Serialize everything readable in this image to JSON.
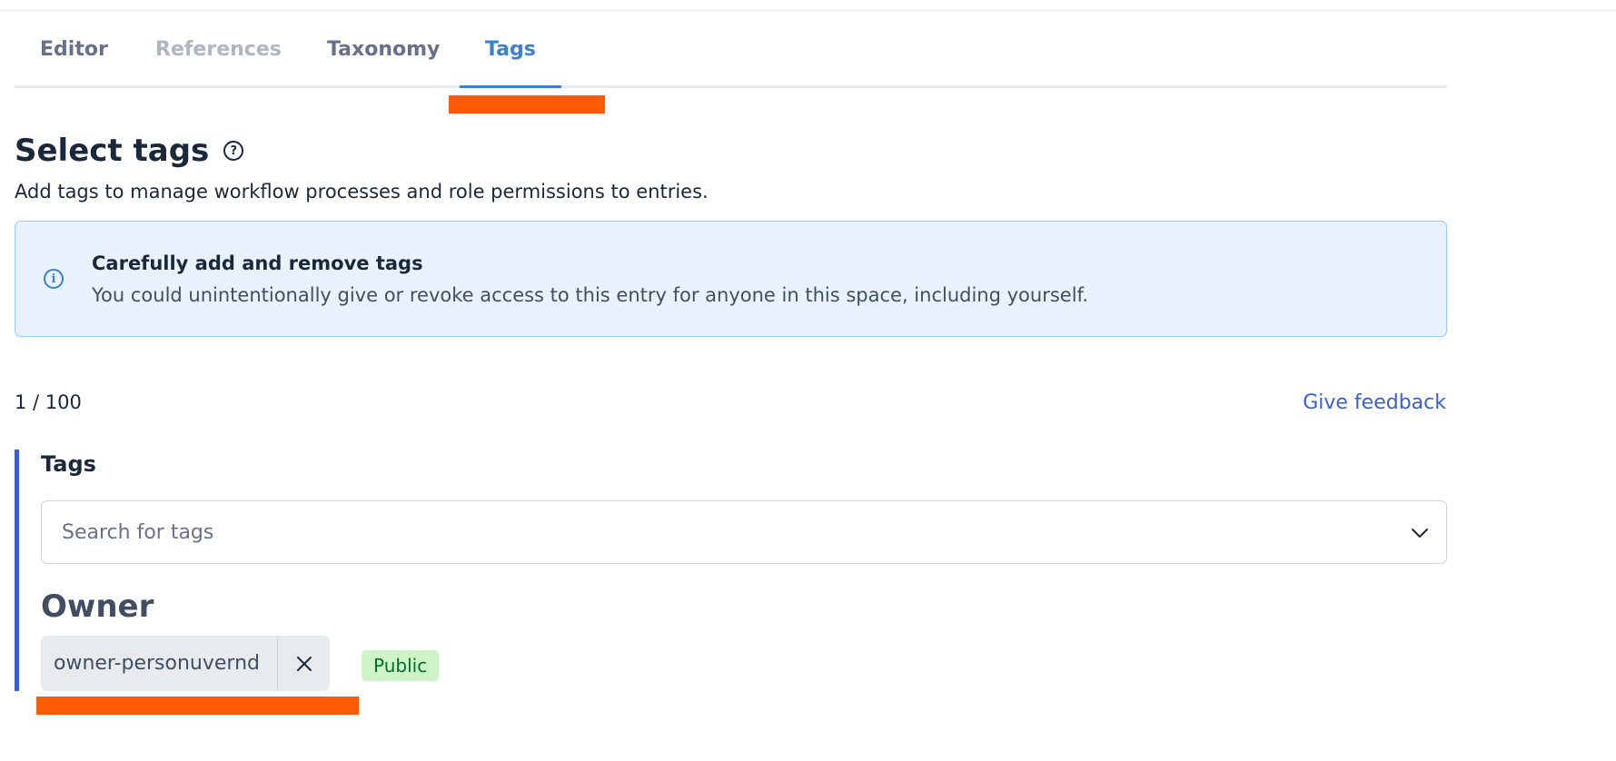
{
  "tabs": [
    {
      "label": "Editor",
      "state": "normal"
    },
    {
      "label": "References",
      "state": "disabled"
    },
    {
      "label": "Taxonomy",
      "state": "normal"
    },
    {
      "label": "Tags",
      "state": "active"
    }
  ],
  "heading": {
    "title": "Select tags",
    "help_icon": "question-circle-icon",
    "subtitle": "Add tags to manage workflow processes and role permissions to entries."
  },
  "note": {
    "icon": "info-circle-icon",
    "title": "Carefully add and remove tags",
    "body": "You could unintentionally give or revoke access to this entry for anyone in this space, including yourself."
  },
  "counter": "1 / 100",
  "feedback_link": "Give feedback",
  "field": {
    "label": "Tags",
    "search_placeholder": "Search for tags",
    "search_value": ""
  },
  "group": {
    "title": "Owner",
    "tags": [
      {
        "label": "owner-personuvernd",
        "visibility": "Public"
      }
    ]
  },
  "colors": {
    "accent": "#3c80cf",
    "link": "#3c5fd0",
    "note_bg": "#e8f2fd",
    "badge_bg": "#cdf3c6",
    "badge_text": "#006e2f",
    "redaction": "#ff5a05"
  }
}
